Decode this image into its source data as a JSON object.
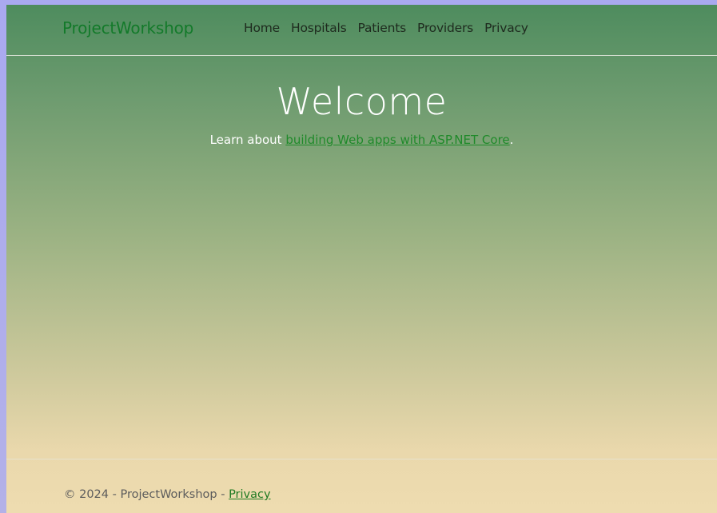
{
  "navbar": {
    "brand": "ProjectWorkshop",
    "links": [
      {
        "label": "Home"
      },
      {
        "label": "Hospitals"
      },
      {
        "label": "Patients"
      },
      {
        "label": "Providers"
      },
      {
        "label": "Privacy"
      }
    ]
  },
  "main": {
    "title": "Welcome",
    "lead_prefix": "Learn about ",
    "lead_link": "building Web apps with ASP.NET Core",
    "lead_suffix": "."
  },
  "footer": {
    "copyright": "© 2024 - ProjectWorkshop - ",
    "privacy_link": "Privacy"
  },
  "colors": {
    "brand": "#137a2a",
    "link": "#1f8a2a",
    "desktop": "#a9a9f0"
  }
}
